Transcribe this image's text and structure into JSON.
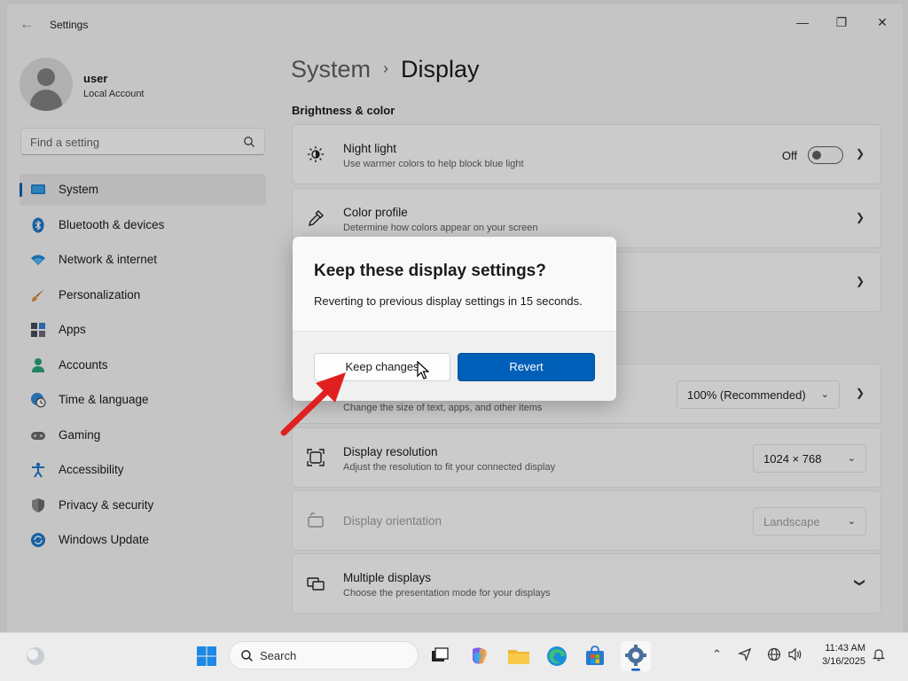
{
  "window": {
    "app_title": "Settings",
    "minimize": "—",
    "maximize": "❐",
    "close": "✕"
  },
  "user": {
    "name": "user",
    "account_type": "Local Account"
  },
  "search": {
    "placeholder": "Find a setting"
  },
  "sidebar": {
    "items": [
      {
        "label": "System",
        "icon": "system-icon",
        "active": true
      },
      {
        "label": "Bluetooth & devices",
        "icon": "bluetooth-icon"
      },
      {
        "label": "Network & internet",
        "icon": "wifi-icon"
      },
      {
        "label": "Personalization",
        "icon": "brush-icon"
      },
      {
        "label": "Apps",
        "icon": "apps-icon"
      },
      {
        "label": "Accounts",
        "icon": "accounts-icon"
      },
      {
        "label": "Time & language",
        "icon": "time-language-icon"
      },
      {
        "label": "Gaming",
        "icon": "gaming-icon"
      },
      {
        "label": "Accessibility",
        "icon": "accessibility-icon"
      },
      {
        "label": "Privacy & security",
        "icon": "shield-icon"
      },
      {
        "label": "Windows Update",
        "icon": "windows-update-icon"
      }
    ]
  },
  "breadcrumb": {
    "parent": "System",
    "separator": "›",
    "current": "Display"
  },
  "main": {
    "section_brightness": "Brightness & color",
    "night_light": {
      "title": "Night light",
      "subtitle": "Use warmer colors to help block blue light",
      "state_label": "Off"
    },
    "color_profile": {
      "title": "Color profile",
      "subtitle": "Determine how colors appear on your screen"
    },
    "scale": {
      "subtitle": "Change the size of text, apps, and other items",
      "value": "100% (Recommended)"
    },
    "resolution": {
      "title": "Display resolution",
      "subtitle": "Adjust the resolution to fit your connected display",
      "value": "1024 × 768"
    },
    "orientation": {
      "title": "Display orientation",
      "value": "Landscape"
    },
    "multiple_displays": {
      "title": "Multiple displays",
      "subtitle": "Choose the presentation mode for your displays"
    }
  },
  "dialog": {
    "title": "Keep these display settings?",
    "message": "Reverting to previous display settings in 15 seconds.",
    "keep_label": "Keep changes",
    "revert_label": "Revert"
  },
  "taskbar": {
    "search_placeholder": "Search",
    "time": "11:43 AM",
    "date": "3/16/2025"
  },
  "colors": {
    "accent": "#005fb8",
    "annotation_arrow": "#e02020"
  }
}
